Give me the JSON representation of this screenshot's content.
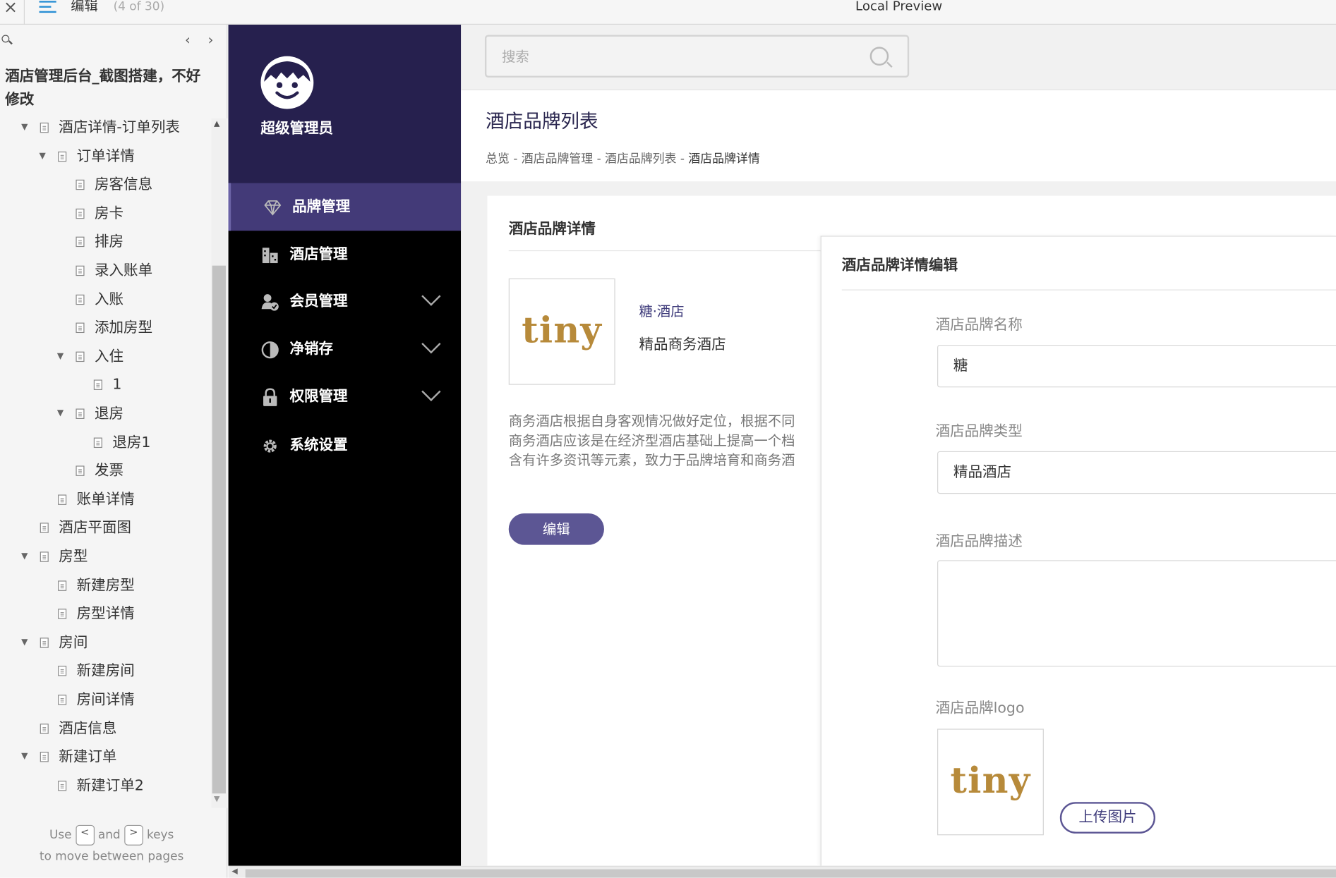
{
  "topbar": {
    "close_glyph": "×",
    "doc_label": "编辑",
    "page_count": "(4 of 30)",
    "title": "Local Preview"
  },
  "sidebar": {
    "project_title": "酒店管理后台_截图搭建，不好修改",
    "tree": [
      {
        "label": "酒店详情-订单列表",
        "level": 1,
        "toggle": "open"
      },
      {
        "label": "订单详情",
        "level": 2,
        "toggle": "open"
      },
      {
        "label": "房客信息",
        "level": 3,
        "toggle": ""
      },
      {
        "label": "房卡",
        "level": 3,
        "toggle": ""
      },
      {
        "label": "排房",
        "level": 3,
        "toggle": ""
      },
      {
        "label": "录入账单",
        "level": 3,
        "toggle": ""
      },
      {
        "label": "入账",
        "level": 3,
        "toggle": ""
      },
      {
        "label": "添加房型",
        "level": 3,
        "toggle": ""
      },
      {
        "label": "入住",
        "level": 3,
        "toggle": "open"
      },
      {
        "label": "1",
        "level": 4,
        "toggle": ""
      },
      {
        "label": "退房",
        "level": 3,
        "toggle": "open"
      },
      {
        "label": "退房1",
        "level": 4,
        "toggle": ""
      },
      {
        "label": "发票",
        "level": 3,
        "toggle": ""
      },
      {
        "label": "账单详情",
        "level": 2,
        "toggle": ""
      },
      {
        "label": "酒店平面图",
        "level": 1,
        "toggle": ""
      },
      {
        "label": "房型",
        "level": 1,
        "toggle": "open"
      },
      {
        "label": "新建房型",
        "level": 2,
        "toggle": ""
      },
      {
        "label": "房型详情",
        "level": 2,
        "toggle": ""
      },
      {
        "label": "房间",
        "level": 1,
        "toggle": "open"
      },
      {
        "label": "新建房间",
        "level": 2,
        "toggle": ""
      },
      {
        "label": "房间详情",
        "level": 2,
        "toggle": ""
      },
      {
        "label": "酒店信息",
        "level": 1,
        "toggle": ""
      },
      {
        "label": "新建订单",
        "level": 1,
        "toggle": "open"
      },
      {
        "label": "新建订单2",
        "level": 2,
        "toggle": ""
      }
    ],
    "hint": {
      "use": "Use",
      "key_prev": "<",
      "and": "and",
      "key_next": ">",
      "keys": "keys",
      "line2": "to move between pages"
    }
  },
  "nav": {
    "role": "超级管理员",
    "items": [
      {
        "label": "品牌管理",
        "icon": "diamond-icon",
        "active": true,
        "expandable": false
      },
      {
        "label": "酒店管理",
        "icon": "building-icon",
        "active": false,
        "expandable": false
      },
      {
        "label": "会员管理",
        "icon": "member-icon",
        "active": false,
        "expandable": true
      },
      {
        "label": "净销存",
        "icon": "pie-icon",
        "active": false,
        "expandable": true
      },
      {
        "label": "权限管理",
        "icon": "lock-icon",
        "active": false,
        "expandable": true
      },
      {
        "label": "系统设置",
        "icon": "gear-icon",
        "active": false,
        "expandable": false
      }
    ]
  },
  "search": {
    "placeholder": "搜索"
  },
  "page": {
    "title": "酒店品牌列表",
    "breadcrumb": [
      "总览",
      "酒店品牌管理",
      "酒店品牌列表",
      "酒店品牌详情"
    ],
    "breadcrumb_sep": " - "
  },
  "detail": {
    "title": "酒店品牌详情",
    "logo_text": "tiny",
    "brand_name": "糖·酒店",
    "brand_type": "精品商务酒店",
    "description": [
      "商务酒店根据自身客观情况做好定位，根据不同",
      "商务酒店应该是在经济型酒店基础上提高一个档",
      "含有许多资讯等元素，致力于品牌培育和商务酒"
    ],
    "edit_label": "编辑"
  },
  "edit_panel": {
    "title": "酒店品牌详情编辑",
    "name_label": "酒店品牌名称",
    "name_value": "糖",
    "type_label": "酒店品牌类型",
    "type_value": "精品酒店",
    "desc_label": "酒店品牌描述",
    "desc_value": "",
    "logo_label": "酒店品牌logo",
    "logo_text": "tiny",
    "upload_label": "上传图片"
  },
  "colors": {
    "nav_bg": "#000000",
    "nav_header": "#26204e",
    "nav_active": "#433a78",
    "accent": "#5c5694",
    "logo_gold": "#b78a3a"
  }
}
